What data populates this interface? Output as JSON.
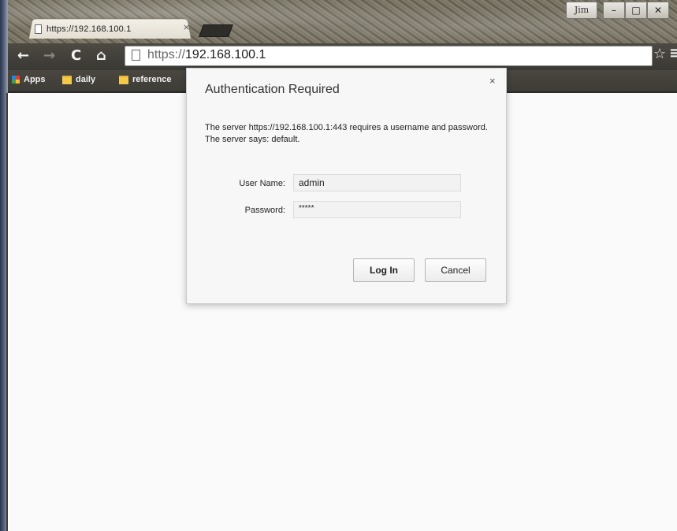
{
  "window": {
    "tab_title": "https://192.168.100.1",
    "tab_close": "×",
    "user_button": "Jim",
    "minimize": "–",
    "maximize": "□",
    "close": "✕"
  },
  "toolbar": {
    "back": "←",
    "forward": "→",
    "reload": "C",
    "home": "⌂",
    "url_scheme": "https://",
    "url_host": "192.168.100.1",
    "star": "☆",
    "menu": "≡"
  },
  "bookmarks": [
    {
      "label": "Apps",
      "icon": "apps-grid-icon"
    },
    {
      "label": "daily",
      "icon": "folder-icon"
    },
    {
      "label": "reference",
      "icon": "folder-icon"
    }
  ],
  "dialog": {
    "title": "Authentication Required",
    "close": "×",
    "message": "The server https://192.168.100.1:443 requires a username and password. The server says: default.",
    "username_label": "User Name:",
    "username_value": "admin",
    "password_label": "Password:",
    "password_value": "*****",
    "login_button": "Log In",
    "cancel_button": "Cancel"
  }
}
